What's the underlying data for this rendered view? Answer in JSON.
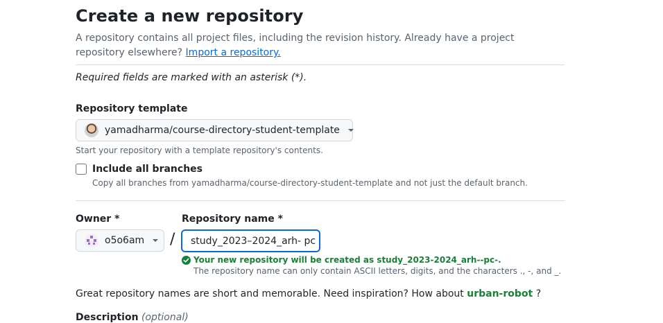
{
  "header": {
    "title": "Create a new repository",
    "intro": "A repository contains all project files, including the revision history. Already have a project repository elsewhere?",
    "import_link": "Import a repository."
  },
  "required_note": "Required fields are marked with an asterisk (*).",
  "template": {
    "label": "Repository template",
    "selected": "yamadharma/course-directory-student-template",
    "hint": "Start your repository with a template repository's contents."
  },
  "branches": {
    "label": "Include all branches",
    "checked": false,
    "hint": "Copy all branches from yamadharma/course-directory-student-template and not just the default branch."
  },
  "owner": {
    "label": "Owner *",
    "value": "o5o6am"
  },
  "separator": "/",
  "repo_name": {
    "label": "Repository name *",
    "value": "study_2023–2024_arh- pc",
    "success": "Your new repository will be created as study_2023-2024_arh--pc-.",
    "rules": "The repository name can only contain ASCII letters, digits, and the characters ., -, and _."
  },
  "suggestion": {
    "text": "Great repository names are short and memorable. Need inspiration? How about",
    "name": "urban-robot",
    "end": "?"
  },
  "description": {
    "label": "Description",
    "optional": "(optional)"
  },
  "colors": {
    "accent": "#0969da",
    "success": "#1a7f37",
    "muted": "#59636e"
  }
}
